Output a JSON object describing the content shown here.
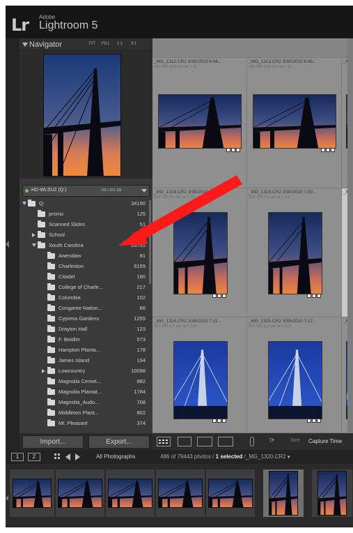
{
  "app": {
    "logo": "Lr",
    "vendor": "Adobe",
    "product": "Lightroom 5"
  },
  "navigator": {
    "title": "Navigator",
    "zoom_options": [
      "FIT",
      "FILL",
      "1:1",
      "3:1"
    ]
  },
  "volume": {
    "name": "HD-WLSU2 (Q:)",
    "space": "105 / 931 GB"
  },
  "folders": [
    {
      "name": "Q:",
      "count": "34190",
      "level": 0,
      "expander": "open"
    },
    {
      "name": "promo",
      "count": "125",
      "level": 1,
      "expander": "none"
    },
    {
      "name": "Scanned Slides",
      "count": "51",
      "level": 1,
      "expander": "none"
    },
    {
      "name": "School",
      "count": "13",
      "level": 1,
      "expander": "closed"
    },
    {
      "name": "South Carolina",
      "count": "25751",
      "level": 1,
      "expander": "open"
    },
    {
      "name": "Awendaw",
      "count": "81",
      "level": 2,
      "expander": "none"
    },
    {
      "name": "Charleston",
      "count": "6159",
      "level": 2,
      "expander": "none"
    },
    {
      "name": "Citadel",
      "count": "180",
      "level": 2,
      "expander": "none"
    },
    {
      "name": "College of Charle...",
      "count": "217",
      "level": 2,
      "expander": "none"
    },
    {
      "name": "Columbia",
      "count": "102",
      "level": 2,
      "expander": "none"
    },
    {
      "name": "Congaree Nation...",
      "count": "86",
      "level": 2,
      "expander": "none"
    },
    {
      "name": "Cypress Gardens",
      "count": "1255",
      "level": 2,
      "expander": "none"
    },
    {
      "name": "Drayton Hall",
      "count": "123",
      "level": 2,
      "expander": "none"
    },
    {
      "name": "F. Beidler",
      "count": "573",
      "level": 2,
      "expander": "none"
    },
    {
      "name": "Hampton Planta...",
      "count": "178",
      "level": 2,
      "expander": "none"
    },
    {
      "name": "James Island",
      "count": "194",
      "level": 2,
      "expander": "none"
    },
    {
      "name": "Lowcountry",
      "count": "10098",
      "level": 2,
      "expander": "closed"
    },
    {
      "name": "Magnolia Cemet...",
      "count": "882",
      "level": 2,
      "expander": "none"
    },
    {
      "name": "Magnolia Plantat...",
      "count": "1784",
      "level": 2,
      "expander": "none"
    },
    {
      "name": "Magnolia_Audo...",
      "count": "708",
      "level": 2,
      "expander": "none"
    },
    {
      "name": "Middleton Plant...",
      "count": "802",
      "level": 2,
      "expander": "none"
    },
    {
      "name": "Mt. Pleasant",
      "count": "374",
      "level": 2,
      "expander": "none"
    }
  ],
  "buttons": {
    "import": "Import...",
    "export": "Export..."
  },
  "grid": {
    "cells": [
      {
        "filename": "_MG_1312.CR2",
        "date": "3/30/2010 6:46...",
        "info": "ISO 100     1/15 sec at f / 11",
        "theme": "sunset"
      },
      {
        "filename": "_MG_1313.CR2",
        "date": "3/30/2010 6:46...",
        "info": "ISO 100     1/15 sec at f / 11",
        "theme": "sunset"
      },
      {
        "filename": "_MG_1318.CR2",
        "date": "3/30/2010 6:58...",
        "info": "ISO 100     0.5 sec at f / 11",
        "theme": "sunset"
      },
      {
        "filename": "_MG_1319.CR2",
        "date": "3/30/2010 7:00...",
        "info": "ISO 100     0.5 sec at f / 11",
        "theme": "sunset"
      },
      {
        "filename": "_MG_1324.CR2",
        "date": "3/30/2010 7:11...",
        "info": "ISO 100     4.0 sec at f / 5.0",
        "theme": "blue"
      },
      {
        "filename": "_MG_1325.CR2",
        "date": "3/30/2010 7:12...",
        "info": "ISO 100     1.0 sec at f / 5.0",
        "theme": "blue"
      }
    ],
    "partial_labels": [
      "_MG_",
      "_MG_",
      "_MG_"
    ]
  },
  "toolbar": {
    "sort_label": "Sort:",
    "sort_value": "Capture Time"
  },
  "filmstrip_bar": {
    "monitor1": "1",
    "monitor2": "2",
    "source": "All Photographs",
    "count_prefix": "486 of 79443 photos /",
    "count_selected": "1 selected",
    "count_suffix": "/_MG_1320.CR2"
  },
  "filmstrip": {
    "themes": [
      "sunset-h",
      "sunset-h",
      "sunset-h",
      "sunset-h",
      "sunset-h",
      "sunset-v",
      "sunset-v"
    ]
  },
  "colors": {
    "annotation_arrow": "#ff1a1a",
    "sky_top": "#152b5e",
    "sky_bottom": "#e56a3a",
    "blue_sky": "#1d3fa8"
  }
}
